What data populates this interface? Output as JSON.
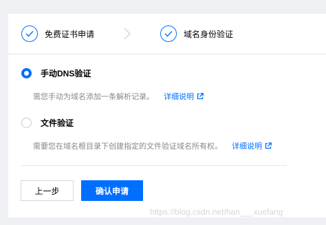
{
  "steps": [
    {
      "label": "免费证书申请",
      "status": "completed"
    },
    {
      "label": "域名身份验证",
      "status": "completed"
    }
  ],
  "options": [
    {
      "label": "手动DNS验证",
      "selected": true,
      "description": "需您手动为域名添加一条解析记录。",
      "link": "详细说明"
    },
    {
      "label": "文件验证",
      "selected": false,
      "description": "需要您在域名根目录下创建指定的文件验证域名所有权。",
      "link": "详细说明"
    }
  ],
  "buttons": {
    "prev": "上一步",
    "confirm": "确认申请"
  },
  "watermark": "https://blog.csdn.net/han___xuefang",
  "colors": {
    "accent": "#006eff",
    "muted_text": "#888888",
    "border": "#e4e6ea"
  },
  "icons": {
    "step_done": "check-circle-icon",
    "step_separator": "chevron-right-icon",
    "external_link": "external-link-icon"
  }
}
